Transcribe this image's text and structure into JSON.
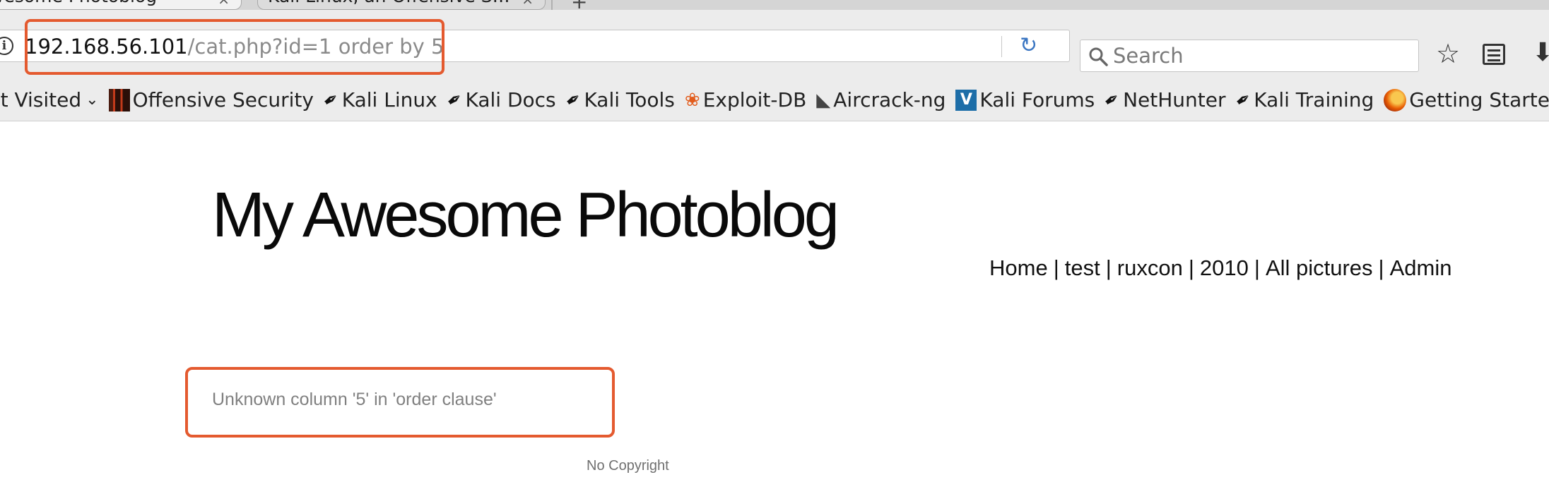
{
  "browser": {
    "tabs": [
      {
        "label": "wesome Photoblog",
        "close": "×",
        "active": true
      },
      {
        "label": "Kali Linux, an Offensive S…",
        "close": "×",
        "active": false
      }
    ],
    "new_tab": "+",
    "url": {
      "host": "192.168.56.101",
      "path": "/cat.php?id=1 order by 5"
    },
    "search": {
      "placeholder": "Search"
    },
    "icons": {
      "info": "i",
      "reload": "↻",
      "star": "☆",
      "download": "⬇",
      "chevron": "⌄"
    },
    "bookmarks": [
      {
        "label": "st Visited",
        "icon": "none"
      },
      {
        "label": "Offensive Security",
        "icon": "offensive-security-icon"
      },
      {
        "label": "Kali Linux",
        "icon": "kali-dragon-icon"
      },
      {
        "label": "Kali Docs",
        "icon": "kali-dragon-icon"
      },
      {
        "label": "Kali Tools",
        "icon": "kali-dragon-icon"
      },
      {
        "label": "Exploit-DB",
        "icon": "exploit-db-icon"
      },
      {
        "label": "Aircrack-ng",
        "icon": "aircrack-icon"
      },
      {
        "label": "Kali Forums",
        "icon": "kali-forums-icon"
      },
      {
        "label": "NetHunter",
        "icon": "kali-dragon-icon"
      },
      {
        "label": "Kali Training",
        "icon": "kali-dragon-icon"
      },
      {
        "label": "Getting Started",
        "icon": "firefox-icon"
      }
    ]
  },
  "page": {
    "title": "My Awesome Photoblog",
    "nav": [
      "Home",
      "test",
      "ruxcon",
      "2010",
      "All pictures",
      "Admin"
    ],
    "nav_separator": "|",
    "error": "Unknown column '5' in 'order clause'",
    "footer": "No Copyright"
  },
  "colors": {
    "highlight": "#e45a2f",
    "reload_icon": "#3b76c2"
  }
}
